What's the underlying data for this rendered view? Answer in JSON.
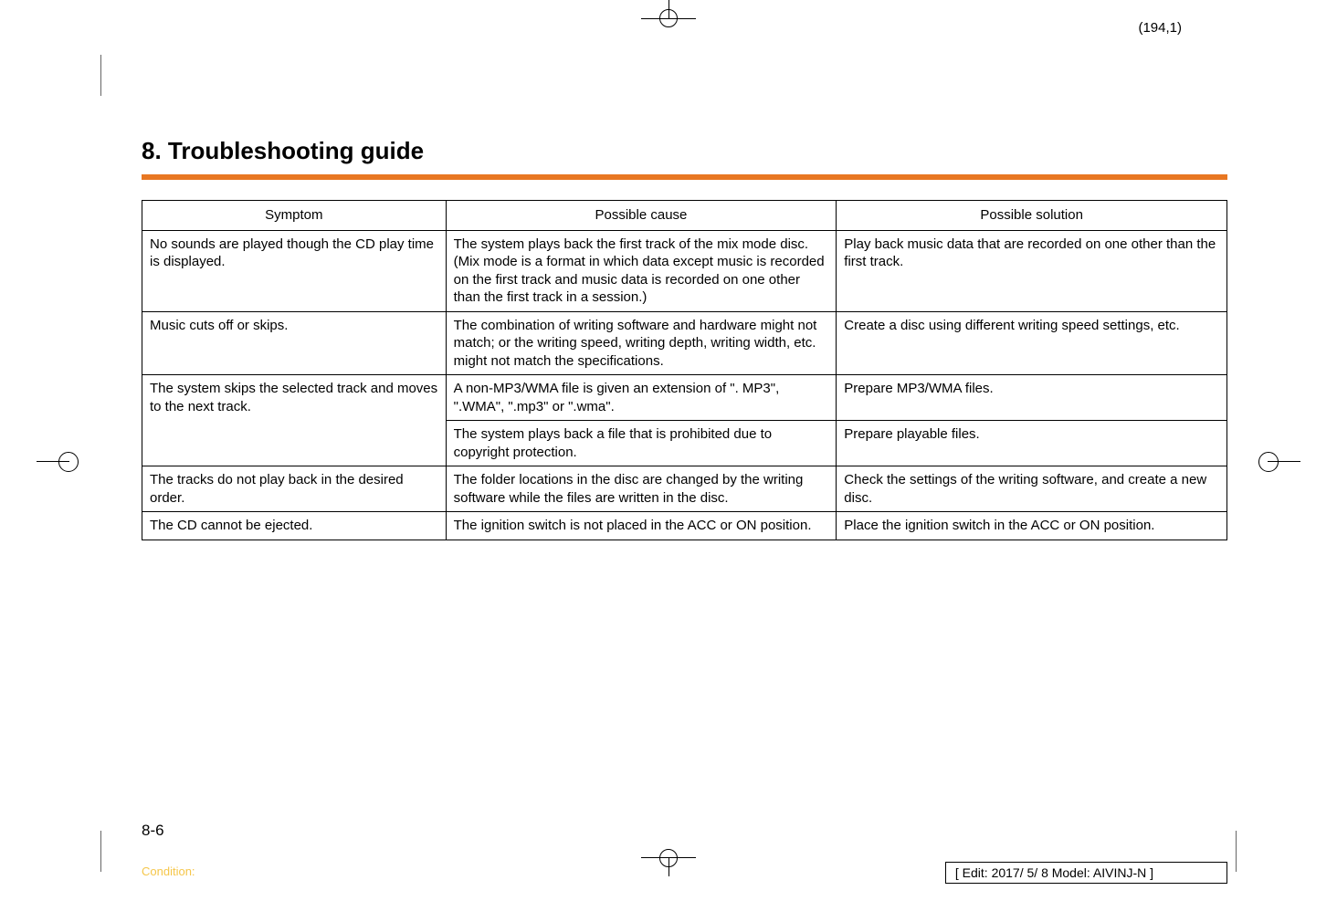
{
  "pageCoord": "(194,1)",
  "title": "8. Troubleshooting guide",
  "headers": [
    "Symptom",
    "Possible cause",
    "Possible solution"
  ],
  "rows": [
    {
      "symptom": "No sounds are played though the CD play time is displayed.",
      "cause": "The system plays back the first track of the mix mode disc. (Mix mode is a format in which data except music is recorded on the first track and music data is recorded on one other than the first track in a session.)",
      "solution": "Play back music data that are recorded on one other than the first track."
    },
    {
      "symptom": "Music cuts off or skips.",
      "cause": "The combination of writing software and hardware might not match; or the writing speed, writing depth, writing width, etc. might not match the specifications.",
      "solution": "Create a disc using different writing speed settings, etc."
    },
    {
      "symptom": "The system skips the selected track and moves to the next track.",
      "cause": "A non-MP3/WMA file is given an extension of \". MP3\", \".WMA\", \".mp3\" or \".wma\".",
      "solution": "Prepare MP3/WMA files.",
      "rowspan": 2
    },
    {
      "cause": "The system plays back a file that is prohibited due to copyright protection.",
      "solution": "Prepare playable files."
    },
    {
      "symptom": "The tracks do not play back in the desired order.",
      "cause": "The folder locations in the disc are changed by the writing software while the files are written in the disc.",
      "solution": "Check the settings of the writing software, and create a new disc."
    },
    {
      "symptom": "The CD cannot be ejected.",
      "cause": "The ignition switch is not placed in the ACC or ON position.",
      "solution": "Place the ignition switch in the ACC or ON position."
    }
  ],
  "pageNum": "8-6",
  "conditionLabel": "Condition:",
  "editInfo": "[ Edit: 2017/ 5/ 8    Model:  AIVINJ-N ]"
}
